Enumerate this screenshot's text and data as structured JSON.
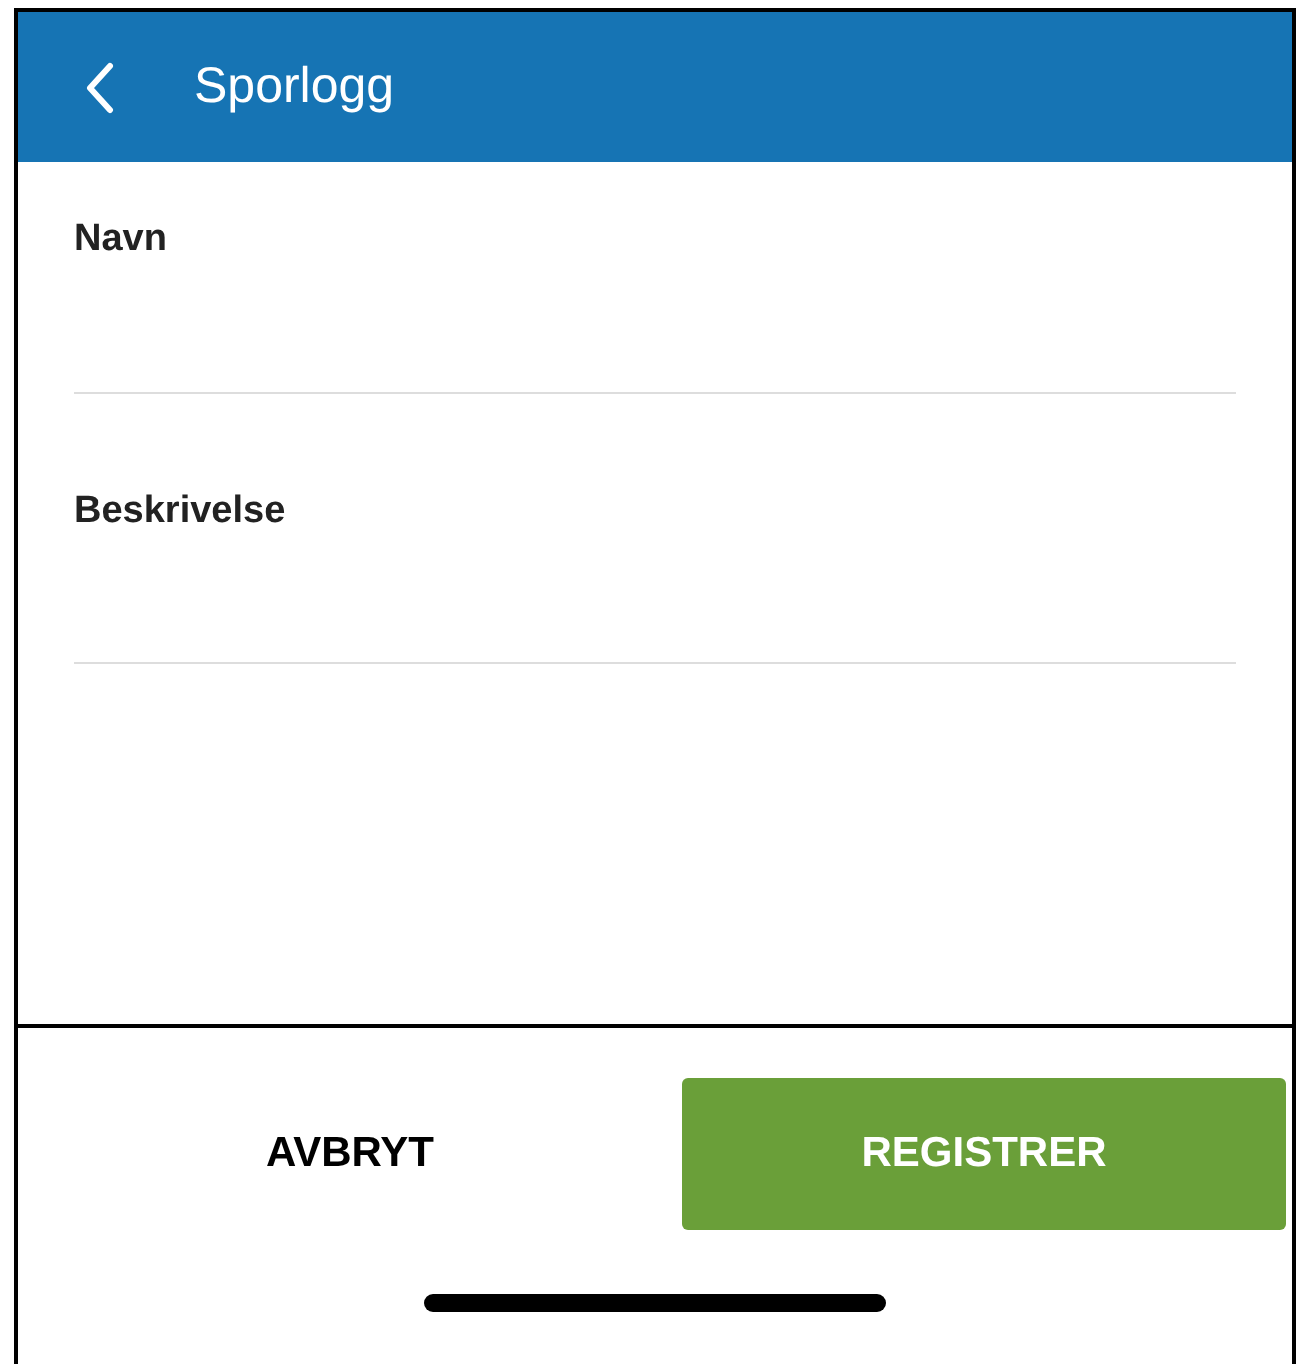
{
  "header": {
    "title": "Sporlogg"
  },
  "fields": [
    {
      "label": "Navn"
    },
    {
      "label": "Beskrivelse"
    }
  ],
  "buttons": [
    {
      "label": "AVBRYT",
      "kind": "text"
    },
    {
      "label": "REGISTRER",
      "kind": "primary"
    }
  ]
}
